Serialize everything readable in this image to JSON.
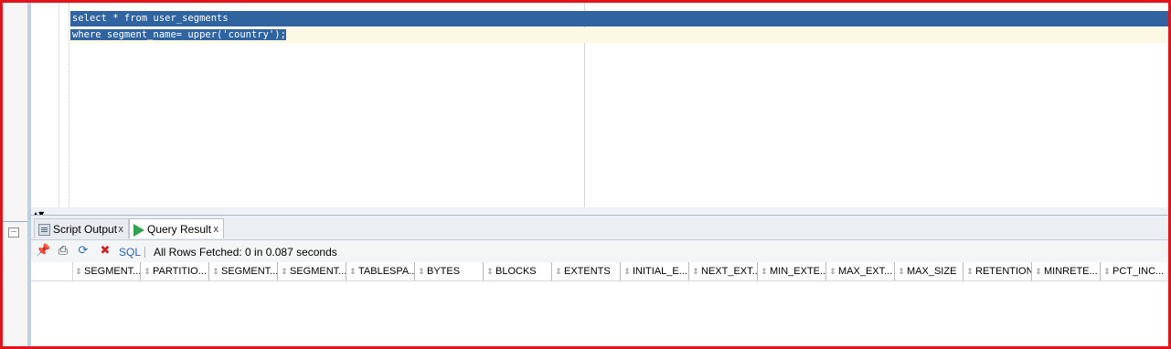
{
  "editor": {
    "line1": "select * from user_segments",
    "line2": "where segment_name= upper('country');"
  },
  "scroll_arrows": "▲▼",
  "gutter": {
    "collapse": "–"
  },
  "tabs": [
    {
      "label": "Script Output",
      "close": "x"
    },
    {
      "label": "Query Result",
      "close": "x"
    }
  ],
  "toolbar": {
    "sql_label": "SQL",
    "separator": "|",
    "status": "All Rows Fetched: 0 in 0.087 seconds",
    "icons": [
      "pin-icon",
      "print-icon",
      "refresh-icon",
      "clear-icon"
    ]
  },
  "columns": [
    "SEGMENT...",
    "PARTITIO...",
    "SEGMENT...",
    "SEGMENT...",
    "TABLESPA...",
    "BYTES",
    "BLOCKS",
    "EXTENTS",
    "INITIAL_E...",
    "NEXT_EXT...",
    "MIN_EXTE...",
    "MAX_EXT...",
    "MAX_SIZE",
    "RETENTION",
    "MINRETE...",
    "PCT_INC..."
  ],
  "sort_glyph": "⇕",
  "colors": {
    "selection": "#2f64a0",
    "frame": "#e2141b",
    "sql_link": "#2a62b3"
  }
}
